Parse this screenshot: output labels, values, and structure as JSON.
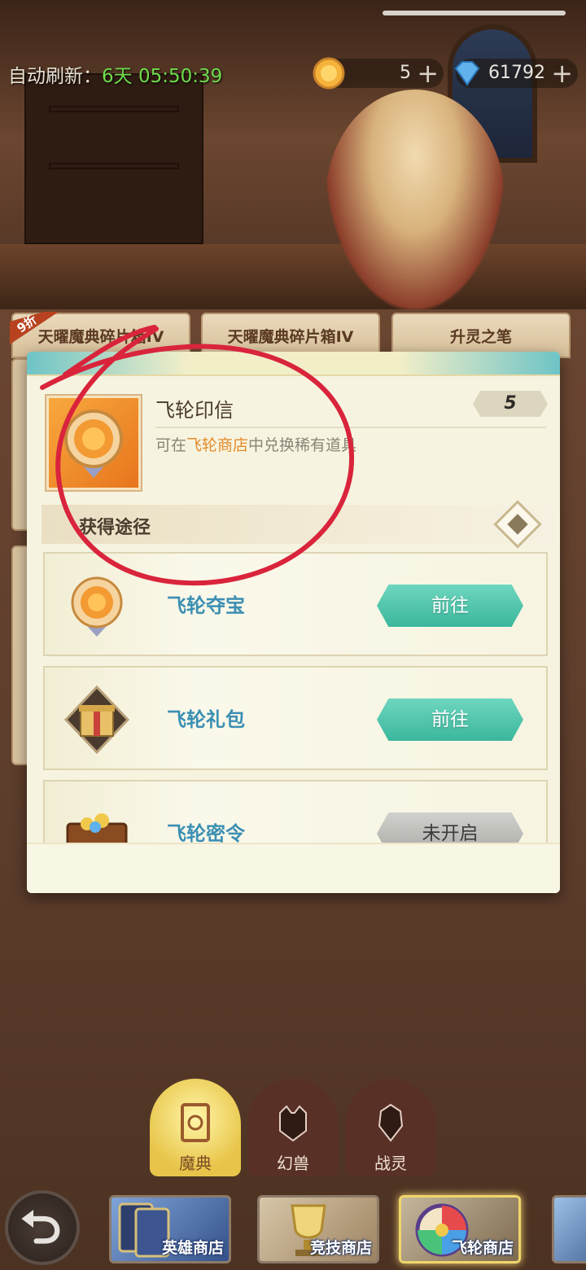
{
  "header": {
    "refresh_label": "自动刷新：",
    "refresh_timer": "6天 05:50:39",
    "coin_value": "5",
    "gem_value": "61792"
  },
  "shop_tabs": [
    {
      "label": "天曜魔典碎片箱IV",
      "discount": "9折"
    },
    {
      "label": "天曜魔典碎片箱IV"
    },
    {
      "label": "升灵之笔"
    }
  ],
  "popup": {
    "item_name": "飞轮印信",
    "item_count": "5",
    "desc_prefix": "可在",
    "desc_highlight": "飞轮商店",
    "desc_suffix": "中兑换稀有道具",
    "section_title": "获得途径",
    "sources": [
      {
        "label": "飞轮夺宝",
        "button": "前往",
        "icon": "coin-medal-icon"
      },
      {
        "label": "飞轮礼包",
        "button": "前往",
        "icon": "gift-box-icon"
      },
      {
        "label": "飞轮密令",
        "button": "未开启",
        "icon": "treasure-chest-icon"
      }
    ]
  },
  "category_tabs": [
    {
      "label": "魔典",
      "icon": "book-icon"
    },
    {
      "label": "幻兽",
      "icon": "beast-icon"
    },
    {
      "label": "战灵",
      "icon": "warrior-icon"
    }
  ],
  "shop_nav": [
    {
      "label": "英雄商店"
    },
    {
      "label": "竞技商店"
    },
    {
      "label": "飞轮商店"
    }
  ],
  "colors": {
    "accent_green": "#3bb79c",
    "highlight_orange": "#e58a2a",
    "source_blue": "#3c8fb3",
    "annotation_red": "#d9243c"
  }
}
